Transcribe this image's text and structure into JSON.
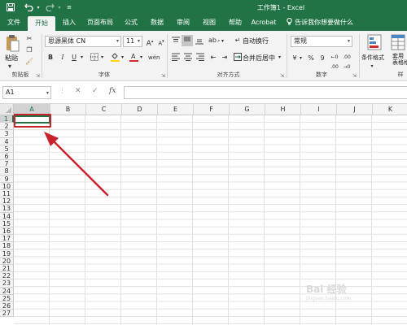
{
  "window": {
    "title": "工作簿1 - Excel",
    "save_icon": "save-icon",
    "undo_icon": "undo-icon",
    "redo_icon": "redo-icon",
    "customize_icon": "customize-quick-access-icon"
  },
  "tabs": [
    {
      "label": "文件",
      "active": false
    },
    {
      "label": "开始",
      "active": true
    },
    {
      "label": "插入",
      "active": false
    },
    {
      "label": "页面布局",
      "active": false
    },
    {
      "label": "公式",
      "active": false
    },
    {
      "label": "数据",
      "active": false
    },
    {
      "label": "审阅",
      "active": false
    },
    {
      "label": "视图",
      "active": false
    },
    {
      "label": "帮助",
      "active": false
    },
    {
      "label": "Acrobat",
      "active": false
    }
  ],
  "tell_me": {
    "text": "告诉我你想要做什么"
  },
  "ribbon": {
    "clipboard": {
      "paste_label": "粘贴",
      "group_label": "剪贴板"
    },
    "font": {
      "font_name": "思源黑体 CN",
      "font_size": "11",
      "grow": "A",
      "shrink": "A",
      "bold": "B",
      "italic": "I",
      "underline": "U",
      "group_label": "字体"
    },
    "alignment": {
      "wrap_text": "自动换行",
      "merge_center": "合并后居中",
      "group_label": "对齐方式"
    },
    "number": {
      "format": "常规",
      "currency": "¥",
      "percent": "%",
      "comma": "9",
      "group_label": "数字"
    },
    "styles": {
      "conditional_formatting": "条件格式",
      "format_table": "套用\n表格格",
      "group_label": "样"
    }
  },
  "formula_bar": {
    "name_box": "A1",
    "cancel": "✕",
    "enter": "✓",
    "fx": "fx",
    "value": ""
  },
  "sheet": {
    "columns": [
      "A",
      "B",
      "C",
      "D",
      "E",
      "F",
      "G",
      "H",
      "I",
      "J",
      "K"
    ],
    "rows": [
      "1",
      "2",
      "3",
      "4",
      "5",
      "6",
      "7",
      "8",
      "9",
      "10",
      "11",
      "12",
      "13",
      "14",
      "15",
      "16",
      "17",
      "18",
      "19",
      "20",
      "21",
      "22",
      "23",
      "24",
      "25",
      "26",
      "27"
    ],
    "active_cell": "A1"
  },
  "annotation": {
    "color": "#c8232c"
  },
  "watermark": {
    "text": "Bai 经验",
    "sub": "jingyan.baidu.com"
  },
  "colors": {
    "excel_green": "#217346",
    "ribbon_bg": "#f3f3f3"
  }
}
